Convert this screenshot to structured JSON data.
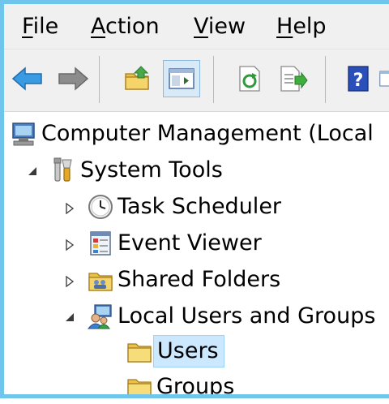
{
  "menu": {
    "file": {
      "u": "F",
      "rest": "ile"
    },
    "action": {
      "u": "A",
      "rest": "ction"
    },
    "view": {
      "u": "V",
      "rest": "iew"
    },
    "help": {
      "u": "H",
      "rest": "elp"
    }
  },
  "toolbar": {
    "icons": [
      "back-arrow-icon",
      "forward-arrow-icon",
      "up-folder-icon",
      "show-hide-console-tree-icon",
      "refresh-icon",
      "export-list-icon",
      "help-icon",
      "action-pane-icon"
    ]
  },
  "tree": {
    "root": "Computer Management (Local",
    "system_tools": "System Tools",
    "task_scheduler": "Task Scheduler",
    "event_viewer": "Event Viewer",
    "shared_folders": "Shared Folders",
    "local_users_groups": "Local Users and Groups",
    "users": "Users",
    "groups": "Groups"
  },
  "colors": {
    "window_frame": "#6fc5ec",
    "selection_bg": "#cce8ff",
    "selection_border": "#99d1ff"
  }
}
